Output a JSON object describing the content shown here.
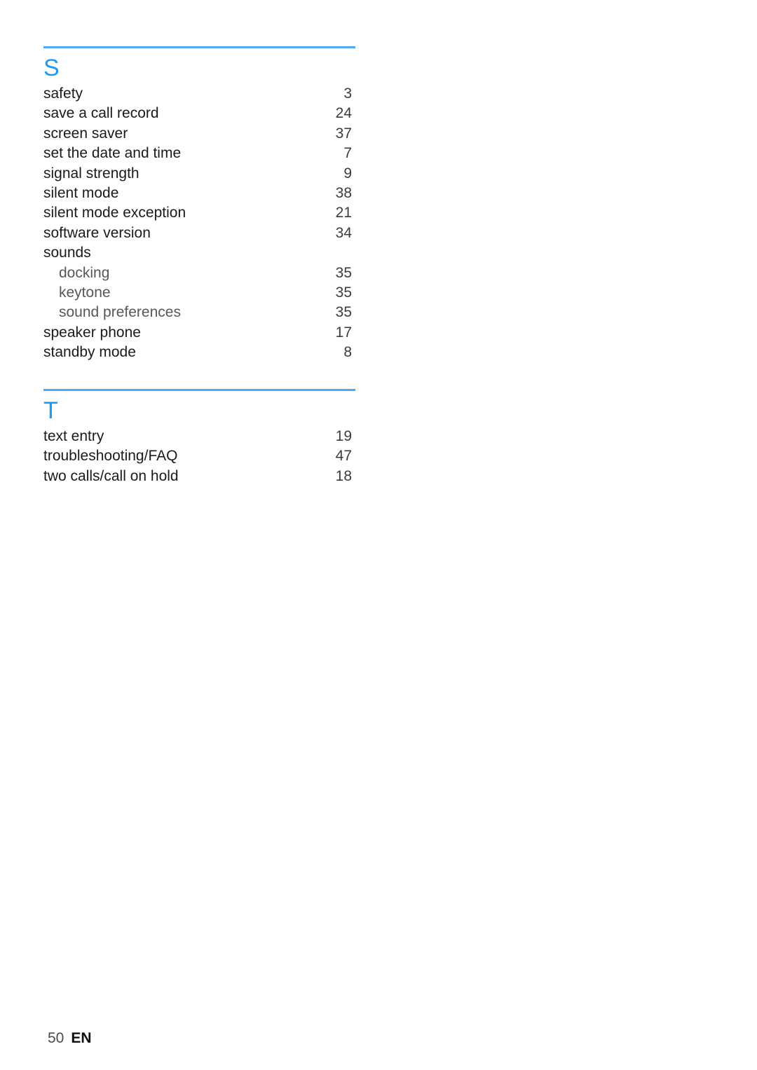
{
  "document": {
    "type": "index",
    "accent_color": "#1e9bf0",
    "rule_color": "#4fa8f2",
    "background_color": "#ffffff",
    "text_color": "#1a1a1a",
    "subentry_text_color": "#575757"
  },
  "sections": [
    {
      "letter": "S",
      "entries": [
        {
          "label": "safety",
          "page": "3",
          "level": 0
        },
        {
          "label": "save a call record",
          "page": "24",
          "level": 0
        },
        {
          "label": "screen saver",
          "page": "37",
          "level": 0
        },
        {
          "label": "set the date and time",
          "page": "7",
          "level": 0
        },
        {
          "label": "signal strength",
          "page": "9",
          "level": 0
        },
        {
          "label": "silent mode",
          "page": "38",
          "level": 0
        },
        {
          "label": "silent mode exception",
          "page": "21",
          "level": 0
        },
        {
          "label": "software version",
          "page": "34",
          "level": 0
        },
        {
          "label": "sounds",
          "page": "",
          "level": 0
        },
        {
          "label": "docking",
          "page": "35",
          "level": 1
        },
        {
          "label": "keytone",
          "page": "35",
          "level": 1
        },
        {
          "label": "sound preferences",
          "page": "35",
          "level": 1
        },
        {
          "label": "speaker phone",
          "page": "17",
          "level": 0
        },
        {
          "label": "standby mode",
          "page": "8",
          "level": 0
        }
      ]
    },
    {
      "letter": "T",
      "entries": [
        {
          "label": "text entry",
          "page": "19",
          "level": 0
        },
        {
          "label": "troubleshooting/FAQ",
          "page": "47",
          "level": 0
        },
        {
          "label": "two calls/call on hold",
          "page": "18",
          "level": 0
        }
      ]
    }
  ],
  "footer": {
    "page_number": "50",
    "language": "EN"
  }
}
